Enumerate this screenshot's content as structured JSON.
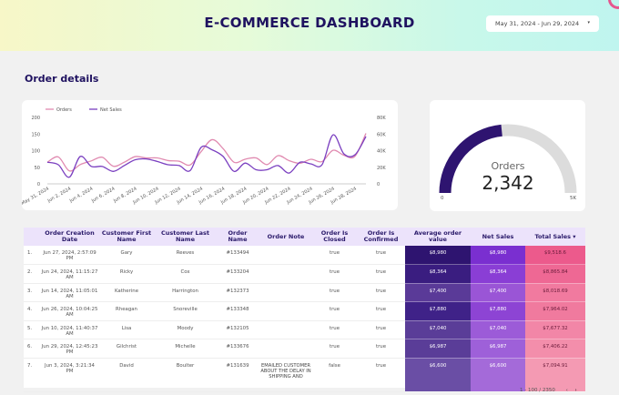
{
  "header": {
    "title": "E-COMMERCE DASHBOARD",
    "date_range": "May 31, 2024 - Jun 29, 2024",
    "date_caret": "▾"
  },
  "section_title": "Order details",
  "chart_data": {
    "type": "line",
    "legend": [
      "Orders",
      "Net Sales"
    ],
    "legend_position": "top-left",
    "x": [
      "May 31, 2024",
      "Jun 1, 2024",
      "Jun 2, 2024",
      "Jun 3, 2024",
      "Jun 4, 2024",
      "Jun 5, 2024",
      "Jun 6, 2024",
      "Jun 7, 2024",
      "Jun 8, 2024",
      "Jun 9, 2024",
      "Jun 10, 2024",
      "Jun 11, 2024",
      "Jun 12, 2024",
      "Jun 13, 2024",
      "Jun 14, 2024",
      "Jun 15, 2024",
      "Jun 16, 2024",
      "Jun 17, 2024",
      "Jun 18, 2024",
      "Jun 19, 2024",
      "Jun 20, 2024",
      "Jun 21, 2024",
      "Jun 22, 2024",
      "Jun 23, 2024",
      "Jun 24, 2024",
      "Jun 25, 2024",
      "Jun 26, 2024",
      "Jun 27, 2024",
      "Jun 28, 2024",
      "Jun 29, 2024"
    ],
    "x_tick_labels": [
      "May 31, 2024",
      "Jun 2, 2024",
      "Jun 4, 2024",
      "Jun 6, 2024",
      "Jun 8, 2024",
      "Jun 10, 2024",
      "Jun 12, 2024",
      "Jun 14, 2024",
      "Jun 16, 2024",
      "Jun 18, 2024",
      "Jun 20, 2024",
      "Jun 22, 2024",
      "Jun 24, 2024",
      "Jun 26, 2024",
      "Jun 28, 2024"
    ],
    "series": [
      {
        "name": "Orders",
        "axis": "left",
        "color": "#e08ab0",
        "values": [
          65,
          81,
          39,
          58,
          69,
          80,
          53,
          65,
          82,
          78,
          78,
          70,
          68,
          57,
          97,
          133,
          106,
          65,
          74,
          78,
          58,
          85,
          70,
          62,
          74,
          67,
          101,
          86,
          83,
          152
        ]
      },
      {
        "name": "Net Sales",
        "axis": "right",
        "color": "#7a3fc0",
        "values": [
          26000,
          23000,
          8000,
          33000,
          21000,
          21000,
          15000,
          22000,
          29000,
          30000,
          27000,
          23000,
          22000,
          16000,
          44000,
          41000,
          33000,
          15000,
          25000,
          17000,
          17000,
          22000,
          13000,
          26000,
          24000,
          23000,
          59000,
          36000,
          35000,
          57000
        ]
      }
    ],
    "y_left": {
      "ylim": [
        0,
        200
      ],
      "ticks": [
        "0",
        "50",
        "100",
        "150",
        "200"
      ]
    },
    "y_right": {
      "ylim": [
        0,
        80000
      ],
      "ticks": [
        "0",
        "20K",
        "40K",
        "60K",
        "80K"
      ]
    },
    "grid": false
  },
  "gauge": {
    "label": "Orders",
    "value": "2,342",
    "value_num": 2342,
    "min": "0",
    "max": "5K",
    "max_num": 5000,
    "fill_color": "#2e1470",
    "track_color": "#dcdcdc"
  },
  "table": {
    "columns": [
      "",
      "Order Creation Date",
      "Customer First Name",
      "Customer Last Name",
      "Order Name",
      "Order Note",
      "Order Is Closed",
      "Order Is Confirmed",
      "Average order value",
      "Net Sales",
      "Total Sales ▾"
    ],
    "rows": [
      {
        "idx": "1.",
        "date": "Jun 27, 2024, 2:57:09 PM",
        "first": "Gary",
        "last": "Reeves",
        "order": "#133494",
        "note": "",
        "closed": "true",
        "confirmed": "true",
        "avg": "$8,980",
        "net": "$8,980",
        "total": "$9,518.6"
      },
      {
        "idx": "2.",
        "date": "Jun 24, 2024, 11:15:27 AM",
        "first": "Ricky",
        "last": "Cox",
        "order": "#133204",
        "note": "",
        "closed": "true",
        "confirmed": "true",
        "avg": "$8,364",
        "net": "$8,364",
        "total": "$8,865.84"
      },
      {
        "idx": "3.",
        "date": "Jun 14, 2024, 11:05:01 AM",
        "first": "Katherine",
        "last": "Harrington",
        "order": "#132373",
        "note": "",
        "closed": "true",
        "confirmed": "true",
        "avg": "$7,400",
        "net": "$7,400",
        "total": "$8,018.69"
      },
      {
        "idx": "4.",
        "date": "Jun 26, 2024, 10:04:25 AM",
        "first": "Rheagan",
        "last": "Snoreville",
        "order": "#133348",
        "note": "",
        "closed": "true",
        "confirmed": "true",
        "avg": "$7,880",
        "net": "$7,880",
        "total": "$7,964.02"
      },
      {
        "idx": "5.",
        "date": "Jun 10, 2024, 11:40:37 AM",
        "first": "Lisa",
        "last": "Moody",
        "order": "#132105",
        "note": "",
        "closed": "true",
        "confirmed": "true",
        "avg": "$7,040",
        "net": "$7,040",
        "total": "$7,677.32"
      },
      {
        "idx": "6.",
        "date": "Jun 29, 2024, 12:45:23 PM",
        "first": "Gilchrist",
        "last": "Michelle",
        "order": "#133676",
        "note": "",
        "closed": "true",
        "confirmed": "true",
        "avg": "$6,987",
        "net": "$6,987",
        "total": "$7,406.22"
      },
      {
        "idx": "7.",
        "date": "Jun 3, 2024, 3:21:34 PM",
        "first": "David",
        "last": "Boulter",
        "order": "#131639",
        "note": "EMAILED CUSTOMER ABOUT THE DELAY IN SHIPPING AND",
        "closed": "false",
        "confirmed": "true",
        "avg": "$6,600",
        "net": "$6,600",
        "total": "$7,094.91"
      }
    ],
    "avg_colors": [
      "#2e1470",
      "#3a1d80",
      "#5a3a98",
      "#3f2288",
      "#5a3d98",
      "#5a3d98",
      "#6a4ea5"
    ],
    "net_colors": [
      "#7a2fd0",
      "#8a3ed5",
      "#9a55d6",
      "#8d44d4",
      "#9c5bd8",
      "#9e60d9",
      "#a46ad9"
    ],
    "total_colors": [
      "#ec5a8c",
      "#ee6894",
      "#f17a9f",
      "#f07a9e",
      "#f286a7",
      "#f38eab",
      "#f49ab3"
    ],
    "pagination": "1 - 100 / 2350",
    "prev": "‹",
    "next": "›"
  }
}
